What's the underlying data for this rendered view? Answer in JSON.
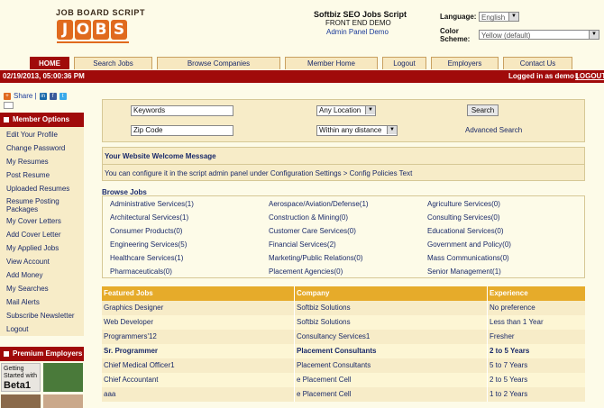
{
  "logo": {
    "top_text": "JOB BOARD SCRIPT",
    "letters": [
      "J",
      "O",
      "B",
      "S"
    ]
  },
  "header": {
    "title": "Softbiz SEO Jobs Script",
    "subtitle": "FRONT END DEMO",
    "admin_link": "Admin Panel Demo",
    "language_label": "Language:",
    "language_value": "English",
    "color_scheme_label": "Color Scheme:",
    "color_scheme_value": "Yellow (default)"
  },
  "nav": {
    "tabs": [
      "HOME",
      "Search Jobs",
      "Browse Companies",
      "Member Home",
      "Logout",
      "Employers",
      "Contact Us"
    ]
  },
  "status_bar": {
    "datetime": "02/19/2013, 05:00:36 PM",
    "logged_in": "Logged in as demo |",
    "logout": "LOGOUT"
  },
  "share": {
    "label": "Share |"
  },
  "sidebar": {
    "member_options_title": "Member Options",
    "items": [
      "Edit Your Profile",
      "Change Password",
      "My Resumes",
      "Post Resume",
      "Uploaded Resumes",
      "Resume Posting Packages",
      "My Cover Letters",
      "Add Cover Letter",
      "My Applied Jobs",
      "View Account",
      "Add Money",
      "My Searches",
      "Mail Alerts",
      "Subscribe Newsletter",
      "Logout"
    ],
    "premium_title": "Premium Employers",
    "premium_caption_small": "Getting Started with",
    "premium_caption_big": "Beta1"
  },
  "search": {
    "keywords_value": "Keywords",
    "zipcode_value": "Zip Code",
    "location_value": "Any Location",
    "distance_value": "Within any distance",
    "search_button": "Search",
    "advanced_link": "Advanced Search"
  },
  "welcome": {
    "title": "Your Website Welcome Message",
    "body": "You can configure it in the script admin panel under Configuration Settings > Config Policies Text"
  },
  "browse": {
    "title": "Browse Jobs",
    "categories": [
      [
        "Administrative Services(1)",
        "Aerospace/Aviation/Defense(1)",
        "Agriculture Services(0)"
      ],
      [
        "Architectural Services(1)",
        "Construction & Mining(0)",
        "Consulting Services(0)"
      ],
      [
        "Consumer Products(0)",
        "Customer Care Services(0)",
        "Educational Services(0)"
      ],
      [
        "Engineering Services(5)",
        "Financial Services(2)",
        "Government and Policy(0)"
      ],
      [
        "Healthcare Services(1)",
        "Marketing/Public Relations(0)",
        "Mass Communications(0)"
      ],
      [
        "Pharmaceuticals(0)",
        "Placement Agencies(0)",
        "Senior Management(1)"
      ]
    ]
  },
  "featured": {
    "headers": [
      "Featured Jobs",
      "Company",
      "Experience"
    ],
    "rows": [
      [
        "Graphics Designer",
        "Softbiz Solutions",
        "No preference"
      ],
      [
        "Web Developer",
        "Softbiz Solutions",
        "Less than 1 Year"
      ],
      [
        "Programmers'12",
        "Consultancy Services1",
        "Fresher"
      ],
      [
        "Sr. Programmer",
        "Placement Consultants",
        "2 to 5 Years"
      ],
      [
        "Chief Medical Officer1",
        "Placement Consultants",
        "5 to 7 Years"
      ],
      [
        "Chief Accountant",
        "e Placement Cell",
        "2 to 5 Years"
      ],
      [
        "aaa",
        "e Placement Cell",
        "1 to 2 Years"
      ]
    ]
  },
  "colors": {
    "brand_red": "#a00a0a",
    "logo_orange": "#e06a1e",
    "table_header": "#e6ab2a",
    "panel": "#f7ecc8"
  }
}
